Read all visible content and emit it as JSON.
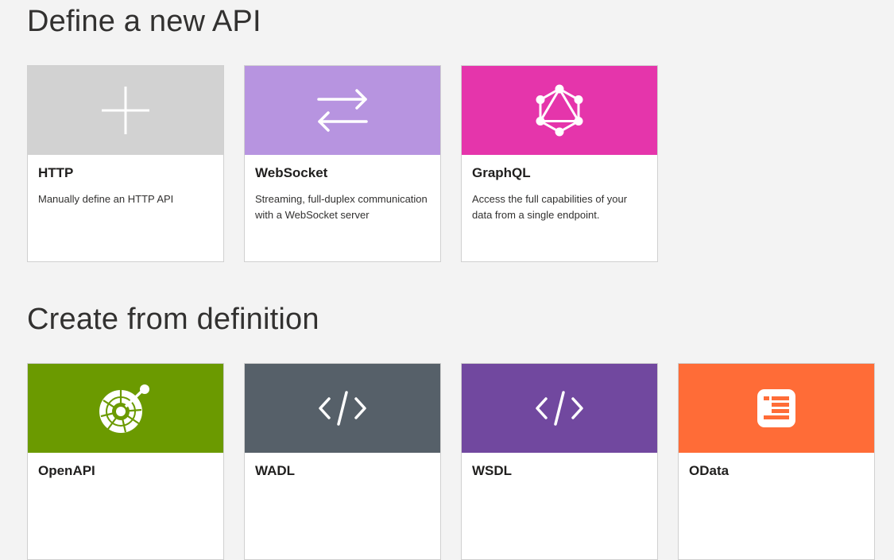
{
  "sections": {
    "define": {
      "title": "Define a new API",
      "cards": [
        {
          "title": "HTTP",
          "description": "Manually define an HTTP API",
          "icon": "plus-icon",
          "color": "#d2d2d2"
        },
        {
          "title": "WebSocket",
          "description": "Streaming, full-duplex communication with a WebSocket server",
          "icon": "swap-arrows-icon",
          "color": "#b794e0"
        },
        {
          "title": "GraphQL",
          "description": "Access the full capabilities of your data from a single endpoint.",
          "icon": "graphql-icon",
          "color": "#e535ab"
        }
      ]
    },
    "create": {
      "title": "Create from definition",
      "cards": [
        {
          "title": "OpenAPI",
          "description": "",
          "icon": "openapi-icon",
          "color": "#6b9a00"
        },
        {
          "title": "WADL",
          "description": "",
          "icon": "code-icon",
          "color": "#566069"
        },
        {
          "title": "WSDL",
          "description": "",
          "icon": "code-icon",
          "color": "#71489f"
        },
        {
          "title": "OData",
          "description": "",
          "icon": "odata-icon",
          "color": "#ff6c37"
        }
      ]
    }
  }
}
